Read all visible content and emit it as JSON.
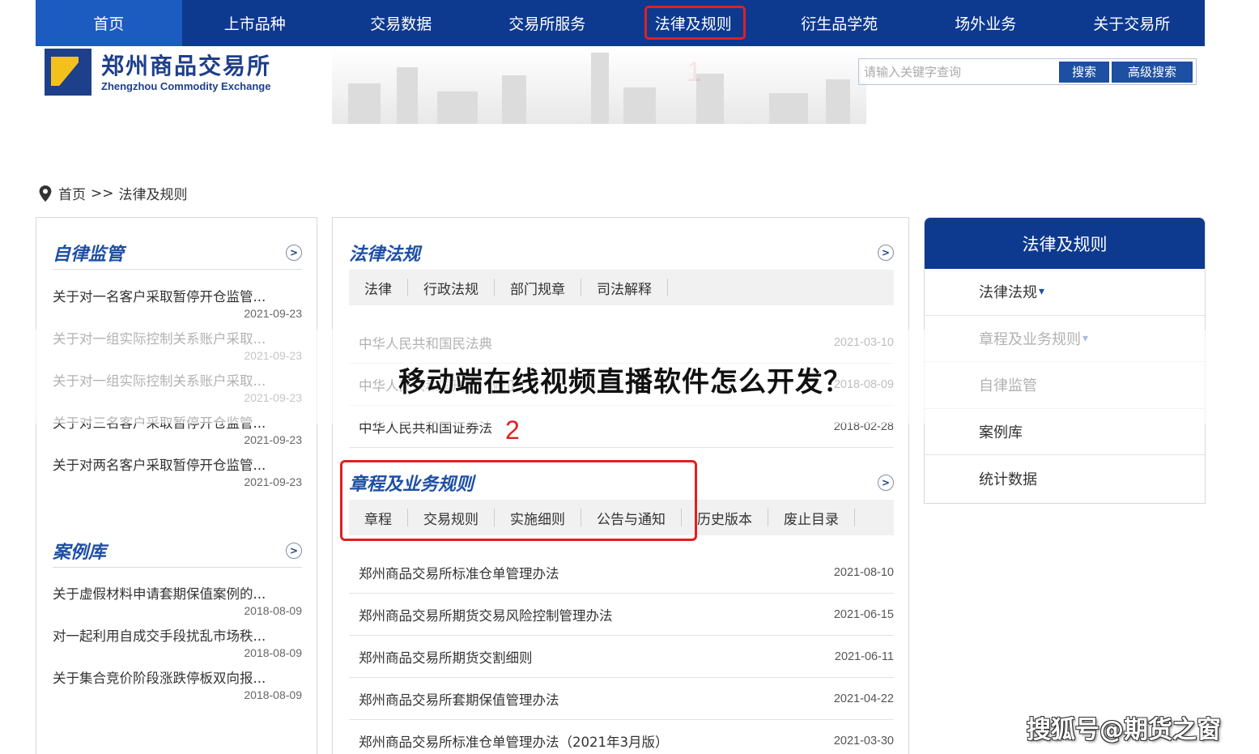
{
  "nav": {
    "items": [
      "首页",
      "上市品种",
      "交易数据",
      "交易所服务",
      "法律及规则",
      "衍生品学苑",
      "场外业务",
      "关于交易所"
    ]
  },
  "annotations": {
    "one": "1",
    "two": "2"
  },
  "logo": {
    "cn": "郑州商品交易所",
    "en": "Zhengzhou Commodity Exchange"
  },
  "search": {
    "placeholder": "请输入关键字查询",
    "search_label": "搜索",
    "advanced_label": "高级搜索"
  },
  "breadcrumb": {
    "home": "首页",
    "separator": ">>",
    "current": "法律及规则"
  },
  "left": {
    "self_reg": {
      "title": "自律监管",
      "items": [
        {
          "title": "关于对一名客户采取暂停开仓监管...",
          "date": "2021-09-23"
        },
        {
          "title": "关于对一组实际控制关系账户采取...",
          "date": "2021-09-23"
        },
        {
          "title": "关于对一组实际控制关系账户采取...",
          "date": "2021-09-23"
        },
        {
          "title": "关于对三名客户采取暂停开仓监管...",
          "date": "2021-09-23"
        },
        {
          "title": "关于对两名客户采取暂停开仓监管...",
          "date": "2021-09-23"
        }
      ]
    },
    "cases": {
      "title": "案例库",
      "items": [
        {
          "title": "关于虚假材料申请套期保值案例的...",
          "date": "2018-08-09"
        },
        {
          "title": "对一起利用自成交手段扰乱市场秩...",
          "date": "2018-08-09"
        },
        {
          "title": "关于集合竞价阶段涨跌停板双向报...",
          "date": "2018-08-09"
        }
      ]
    }
  },
  "middle": {
    "laws": {
      "title": "法律法规",
      "tabs": [
        "法律",
        "行政法规",
        "部门规章",
        "司法解释"
      ],
      "rows": [
        {
          "title": "中华人民共和国民法典",
          "date": "2021-03-10"
        },
        {
          "title": "中华人民共和国刑法（修正）",
          "date": "2018-08-09"
        },
        {
          "title": "中华人民共和国证券法",
          "date": "2018-02-28"
        }
      ]
    },
    "rules": {
      "title": "章程及业务规则",
      "tabs": [
        "章程",
        "交易规则",
        "实施细则",
        "公告与通知",
        "历史版本",
        "废止目录"
      ],
      "rows": [
        {
          "title": "郑州商品交易所标准仓单管理办法",
          "date": "2021-08-10"
        },
        {
          "title": "郑州商品交易所期货交易风险控制管理办法",
          "date": "2021-06-15"
        },
        {
          "title": "郑州商品交易所期货交割细则",
          "date": "2021-06-11"
        },
        {
          "title": "郑州商品交易所套期保值管理办法",
          "date": "2021-04-22"
        },
        {
          "title": "郑州商品交易所标准仓单管理办法（2021年3月版）",
          "date": "2021-03-30"
        }
      ]
    }
  },
  "sidebar": {
    "title": "法律及规则",
    "items": [
      {
        "label": "法律法规",
        "caret": "▾"
      },
      {
        "label": "章程及业务规则",
        "caret": "▾"
      },
      {
        "label": "自律监管",
        "caret": ""
      },
      {
        "label": "案例库",
        "caret": ""
      },
      {
        "label": "统计数据",
        "caret": ""
      }
    ]
  },
  "overlay": {
    "title": "移动端在线视频直播软件怎么开发？"
  },
  "watermark": "搜狐号@期货之窗",
  "colors": {
    "nav": "#0d3a8f",
    "nav_active": "#1c5bc0",
    "accent": "#1d4fa3",
    "annotation": "#e02020"
  }
}
